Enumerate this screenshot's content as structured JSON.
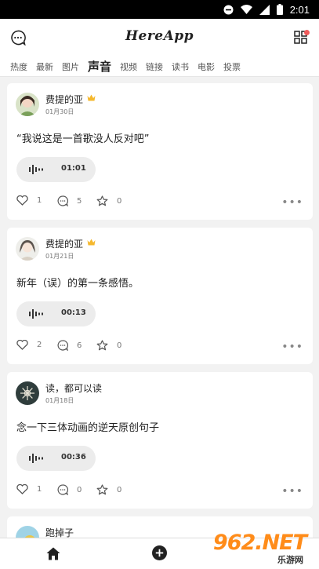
{
  "status": {
    "time": "2:01"
  },
  "header": {
    "logo": "HereApp"
  },
  "tabs": [
    {
      "label": "热度",
      "active": false
    },
    {
      "label": "最新",
      "active": false
    },
    {
      "label": "图片",
      "active": false
    },
    {
      "label": "声音",
      "active": true
    },
    {
      "label": "视频",
      "active": false
    },
    {
      "label": "链接",
      "active": false
    },
    {
      "label": "读书",
      "active": false
    },
    {
      "label": "电影",
      "active": false
    },
    {
      "label": "投票",
      "active": false
    }
  ],
  "posts": [
    {
      "user": "费提的亚",
      "vip": true,
      "date": "01月30日",
      "text": "“我说这是一首歌没人反对吧”",
      "duration": "01:01",
      "likes": "1",
      "comments": "5",
      "stars": "0"
    },
    {
      "user": "费提的亚",
      "vip": true,
      "date": "01月21日",
      "text": "新年（误）的第一条感悟。",
      "duration": "00:13",
      "likes": "2",
      "comments": "6",
      "stars": "0"
    },
    {
      "user": "读，都可以读",
      "vip": false,
      "date": "01月18日",
      "text": "念一下三体动画的逆天原创句子",
      "duration": "00:36",
      "likes": "1",
      "comments": "0",
      "stars": "0"
    },
    {
      "user": "跑掉子",
      "vip": false
    }
  ],
  "watermark": {
    "main": "962.NET",
    "sub": "乐游网"
  },
  "colors": {
    "accent_badge": "#f05a5a",
    "crown": "#f5b82e",
    "watermark": "#ff8c1a"
  }
}
